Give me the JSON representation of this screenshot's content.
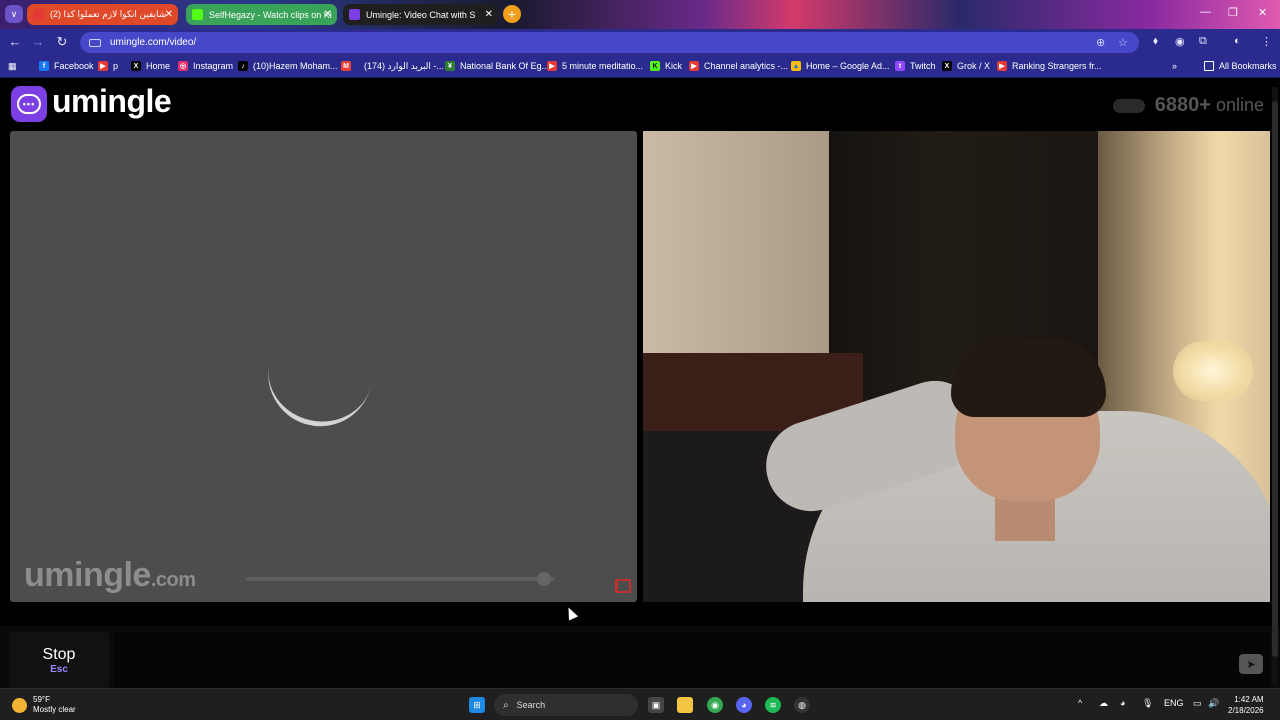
{
  "browser": {
    "tabs": [
      {
        "title": "(2) شايفين انكوا لازم تعملوا كذا",
        "color": "#e53935"
      },
      {
        "title": "SelfHegazy - Watch clips on Ki",
        "color": "#53fc18"
      },
      {
        "title": "Umingle: Video Chat with S",
        "color": "#7b3fe4"
      }
    ],
    "url": "umingle.com/video/",
    "bookmarks": [
      {
        "label": "Facebook",
        "icon": "facebook-icon",
        "color": "#1877f2",
        "glyph": "f"
      },
      {
        "label": "p",
        "icon": "youtube-icon",
        "color": "#e53935",
        "glyph": "▶"
      },
      {
        "label": "Home",
        "icon": "x-icon",
        "color": "#000000",
        "glyph": "X"
      },
      {
        "label": "Instagram",
        "icon": "instagram-icon",
        "color": "#e1306c",
        "glyph": "◎"
      },
      {
        "label": "(10)Hazem Moham...",
        "icon": "tiktok-icon",
        "color": "#000000",
        "glyph": "♪"
      },
      {
        "label": "",
        "icon": "gmail-icon",
        "color": "#ea4335",
        "glyph": "M"
      },
      {
        "label": "(174) البريد الوارد -...",
        "icon": "outlook-icon",
        "color": "#0a64d8",
        "glyph": ""
      },
      {
        "label": "National Bank Of Eg...",
        "icon": "nbe-icon",
        "color": "#2e7d32",
        "glyph": "¥"
      },
      {
        "label": "5 minute meditatio...",
        "icon": "youtube-icon",
        "color": "#e53935",
        "glyph": "▶"
      },
      {
        "label": "Kick",
        "icon": "kick-icon",
        "color": "#53fc18",
        "glyph": "K"
      },
      {
        "label": "Channel analytics -...",
        "icon": "youtube-icon",
        "color": "#e53935",
        "glyph": "▶"
      },
      {
        "label": "Home – Google Ad...",
        "icon": "google-ads-icon",
        "color": "#fbbc04",
        "glyph": "▲"
      },
      {
        "label": "Twitch",
        "icon": "twitch-icon",
        "color": "#9146ff",
        "glyph": "t"
      },
      {
        "label": "Grok / X",
        "icon": "x-icon",
        "color": "#000000",
        "glyph": "X"
      },
      {
        "label": "Ranking Strangers fr...",
        "icon": "youtube-icon",
        "color": "#e53935",
        "glyph": "▶"
      }
    ],
    "all_bookmarks": "All Bookmarks"
  },
  "site": {
    "logo": "umingle",
    "online_count": "6880+",
    "online_label": "online",
    "watermark": "umingle",
    "watermark_domain": ".com",
    "volume": 0.99,
    "stop_label": "Stop",
    "stop_key": "Esc"
  },
  "taskbar": {
    "temp": "59°F",
    "condition": "Mostly clear",
    "search": "Search",
    "lang": "ENG",
    "time": "1:42 AM",
    "date": "2/18/2026"
  },
  "colors": {
    "brand": "#7b3fe4",
    "report": "#c23030",
    "esc": "#9a85ff"
  }
}
